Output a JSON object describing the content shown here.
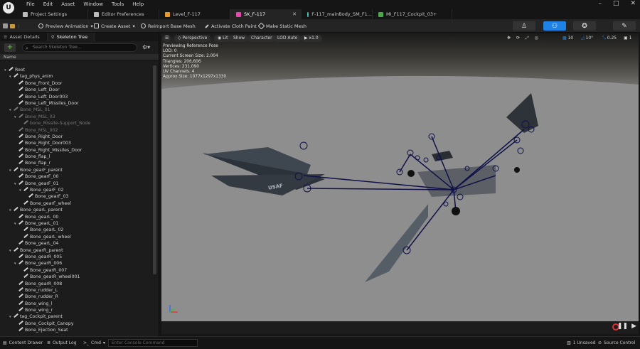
{
  "menu": [
    "File",
    "Edit",
    "Asset",
    "Window",
    "Tools",
    "Help"
  ],
  "tabs": [
    {
      "label": "Project Settings",
      "icon": "settings-icon",
      "color": "#bbbbbb"
    },
    {
      "label": "Editor Preferences",
      "icon": "preferences-icon",
      "color": "#bbbbbb"
    },
    {
      "label": "Level_F-117",
      "icon": "level-icon",
      "color": "#e69a2e"
    },
    {
      "label": "SK_F-117",
      "icon": "skeletal-mesh-icon",
      "color": "#e04aa8",
      "active": true
    },
    {
      "label": "F-117_mainBody_SM_F1...",
      "icon": "static-mesh-icon",
      "color": "#3fb8b0"
    },
    {
      "label": "MI_F117_Cockpit_03+",
      "icon": "material-instance-icon",
      "color": "#4ca64c"
    }
  ],
  "toolbar": {
    "preview_animation": "Preview Animation",
    "create_asset": "Create Asset",
    "reimport": "Reimport Base Mesh",
    "cloth_paint": "Activate Cloth Paint",
    "make_static_mesh": "Make Static Mesh"
  },
  "left_tabs": [
    "Asset Details",
    "Skeleton Tree"
  ],
  "search_placeholder": "Search Skeleton Tree...",
  "column_name": "Name",
  "tree": [
    {
      "label": "Root",
      "indent": 0,
      "arrow": true
    },
    {
      "label": "tag_phys_anim",
      "indent": 1,
      "arrow": true
    },
    {
      "label": "Bone_Front_Door",
      "indent": 2
    },
    {
      "label": "Bone_Left_Door",
      "indent": 2
    },
    {
      "label": "Bone_Left_Door003",
      "indent": 2
    },
    {
      "label": "Bone_Left_Missiles_Door",
      "indent": 2
    },
    {
      "label": "Bone_MSL_01",
      "indent": 1,
      "arrow": true,
      "dim": true
    },
    {
      "label": "Bone_MSL_03",
      "indent": 2,
      "arrow": true,
      "dim": true
    },
    {
      "label": "bone_Missile-Support_Node",
      "indent": 3,
      "dim": true
    },
    {
      "label": "Bone_MSL_002",
      "indent": 2,
      "dim": true
    },
    {
      "label": "Bone_Right_Door",
      "indent": 2
    },
    {
      "label": "Bone_Right_Door003",
      "indent": 2
    },
    {
      "label": "Bone_Right_Missiles_Door",
      "indent": 2
    },
    {
      "label": "Bone_flap_l",
      "indent": 2
    },
    {
      "label": "Bone_flap_r",
      "indent": 2
    },
    {
      "label": "Bone_gearF_parent",
      "indent": 1,
      "arrow": true
    },
    {
      "label": "Bone_gearF_00",
      "indent": 2
    },
    {
      "label": "Bone_gearF_01",
      "indent": 2,
      "arrow": true
    },
    {
      "label": "Bone_gearF_02",
      "indent": 3,
      "arrow": true
    },
    {
      "label": "Bone_gearF_03",
      "indent": 4
    },
    {
      "label": "Bone_gearF_wheel",
      "indent": 3
    },
    {
      "label": "Bone_gearL_parent",
      "indent": 1,
      "arrow": true
    },
    {
      "label": "Bone_gearL_00",
      "indent": 2
    },
    {
      "label": "Bone_gearL_01",
      "indent": 2,
      "arrow": true
    },
    {
      "label": "Bone_gearL_02",
      "indent": 3
    },
    {
      "label": "Bone_gearL_wheel",
      "indent": 3
    },
    {
      "label": "Bone_gearL_04",
      "indent": 2
    },
    {
      "label": "Bone_gearR_parent",
      "indent": 1,
      "arrow": true
    },
    {
      "label": "Bone_gearR_005",
      "indent": 2
    },
    {
      "label": "Bone_gearR_006",
      "indent": 2,
      "arrow": true
    },
    {
      "label": "Bone_gearR_007",
      "indent": 3
    },
    {
      "label": "Bone_gearR_wheel001",
      "indent": 3
    },
    {
      "label": "Bone_gearR_008",
      "indent": 2
    },
    {
      "label": "Bone_rudder_L",
      "indent": 2
    },
    {
      "label": "Bone_rudder_R",
      "indent": 2
    },
    {
      "label": "Bone_wing_l",
      "indent": 2
    },
    {
      "label": "Bone_wing_r",
      "indent": 2
    },
    {
      "label": "tag_Cockpit_parent",
      "indent": 1,
      "arrow": true
    },
    {
      "label": "Bone_Cockpit_Canopy",
      "indent": 2
    },
    {
      "label": "Bone_Ejection_Seat",
      "indent": 2
    }
  ],
  "viewport": {
    "perspective": "Perspective",
    "lit": "Lit",
    "show": "Show",
    "character": "Character",
    "lod": "LOD Auto",
    "speed": "x1.0",
    "grid": "10",
    "angle": "10°",
    "scale": "0.25",
    "camera_speed": "1",
    "stats": [
      "Previewing Reference Pose",
      "LOD: 0",
      "Current Screen Size: 2.004",
      "Triangles: 206,606",
      "Vertices: 231,090",
      "UV Channels: 4",
      "Approx Size: 1077x1297x1330"
    ],
    "wing_label": "USAF"
  },
  "status": {
    "content_drawer": "Content Drawer",
    "output_log": "Output Log",
    "cmd": "Cmd",
    "console_placeholder": "Enter Console Command",
    "unsaved": "1 Unsaved",
    "source_control": "Source Control"
  },
  "colors": {
    "accent": "#1e82e6",
    "bone": "#11114a",
    "add": "#4caf2a"
  }
}
